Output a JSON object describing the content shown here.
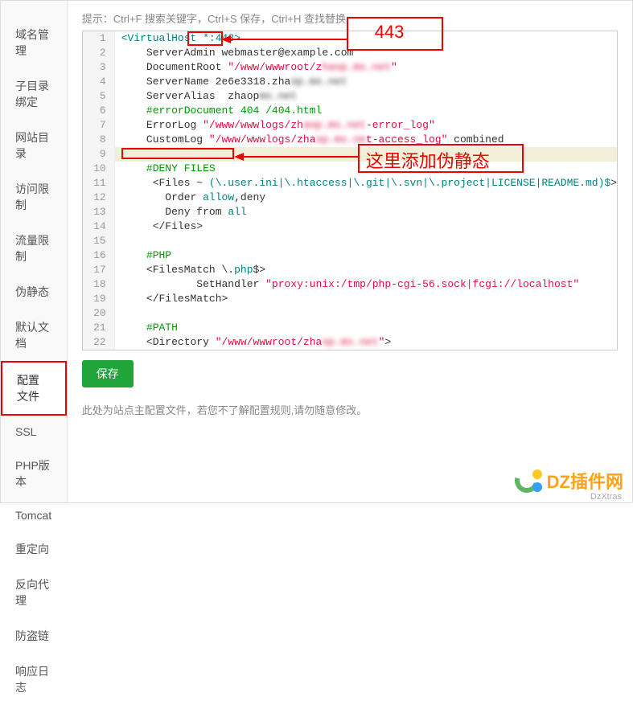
{
  "sidebar": {
    "items": [
      {
        "label": "域名管理",
        "name": "domain-manage"
      },
      {
        "label": "子目录绑定",
        "name": "subdir-bind"
      },
      {
        "label": "网站目录",
        "name": "site-dir"
      },
      {
        "label": "访问限制",
        "name": "access-limit"
      },
      {
        "label": "流量限制",
        "name": "traffic-limit"
      },
      {
        "label": "伪静态",
        "name": "rewrite"
      },
      {
        "label": "默认文档",
        "name": "default-doc"
      },
      {
        "label": "配置文件",
        "name": "config-file",
        "active": true
      },
      {
        "label": "SSL",
        "name": "ssl"
      },
      {
        "label": "PHP版本",
        "name": "php-version"
      },
      {
        "label": "Tomcat",
        "name": "tomcat"
      },
      {
        "label": "重定向",
        "name": "redirect"
      },
      {
        "label": "反向代理",
        "name": "reverse-proxy"
      },
      {
        "label": "防盗链",
        "name": "hotlink"
      },
      {
        "label": "响应日志",
        "name": "response-log"
      }
    ]
  },
  "hint": "提示：Ctrl+F 搜索关键字，Ctrl+S 保存，Ctrl+H 查找替换",
  "annotations": {
    "top_label": "443",
    "right_label": "这里添加伪静态"
  },
  "code_lines": [
    {
      "n": 1,
      "segs": [
        {
          "t": "<VirtualHost *:",
          "c": "tag"
        },
        {
          "t": "443",
          "c": "tag"
        },
        {
          "t": ">",
          "c": "tag"
        }
      ]
    },
    {
      "n": 2,
      "segs": [
        {
          "t": "    ServerAdmin webmaster@example.com",
          "c": "plain"
        }
      ]
    },
    {
      "n": 3,
      "segs": [
        {
          "t": "    DocumentRoot ",
          "c": "plain"
        },
        {
          "t": "\"/www/wwwroot/z",
          "c": "string"
        },
        {
          "t": "haop.ms.net",
          "c": "string",
          "blur": true
        },
        {
          "t": "\"",
          "c": "string"
        }
      ]
    },
    {
      "n": 4,
      "segs": [
        {
          "t": "    ServerName 2e6e3318.zha",
          "c": "plain"
        },
        {
          "t": "op.ms.net",
          "c": "plain",
          "blur": true
        }
      ]
    },
    {
      "n": 5,
      "segs": [
        {
          "t": "    ServerAlias  zhaop",
          "c": "plain"
        },
        {
          "t": "ms.net",
          "c": "plain",
          "blur": true
        }
      ]
    },
    {
      "n": 6,
      "segs": [
        {
          "t": "    #errorDocument 404 /404.html",
          "c": "comment"
        }
      ]
    },
    {
      "n": 7,
      "segs": [
        {
          "t": "    ErrorLog ",
          "c": "plain"
        },
        {
          "t": "\"/www/wwwlogs/zh",
          "c": "string"
        },
        {
          "t": "aop.ms.net",
          "c": "string",
          "blur": true
        },
        {
          "t": "-error_log\"",
          "c": "string"
        }
      ]
    },
    {
      "n": 8,
      "segs": [
        {
          "t": "    CustomLog ",
          "c": "plain"
        },
        {
          "t": "\"/www/wwwlogs/zha",
          "c": "string"
        },
        {
          "t": "op.ms.ne",
          "c": "string",
          "blur": true
        },
        {
          "t": "t-access_log\"",
          "c": "string"
        },
        {
          "t": " combined",
          "c": "plain"
        }
      ]
    },
    {
      "n": 9,
      "hl": true,
      "segs": [
        {
          "t": "",
          "c": "plain"
        }
      ],
      "cursor": true
    },
    {
      "n": 10,
      "segs": [
        {
          "t": "    #DENY FILES",
          "c": "comment"
        }
      ]
    },
    {
      "n": 11,
      "segs": [
        {
          "t": "     <Files ~ ",
          "c": "plain"
        },
        {
          "t": "(\\.user.ini|\\.htaccess|\\.git|\\.svn|\\.project|LICENSE|README.md)$",
          "c": "tag"
        },
        {
          "t": ">",
          "c": "plain"
        }
      ]
    },
    {
      "n": 12,
      "segs": [
        {
          "t": "       Order ",
          "c": "plain"
        },
        {
          "t": "allow",
          "c": "attr"
        },
        {
          "t": ",deny",
          "c": "plain"
        }
      ]
    },
    {
      "n": 13,
      "segs": [
        {
          "t": "       Deny from ",
          "c": "plain"
        },
        {
          "t": "all",
          "c": "attr"
        }
      ]
    },
    {
      "n": 14,
      "segs": [
        {
          "t": "     </Files>",
          "c": "plain"
        }
      ]
    },
    {
      "n": 15,
      "segs": [
        {
          "t": "",
          "c": "plain"
        }
      ]
    },
    {
      "n": 16,
      "segs": [
        {
          "t": "    #PHP",
          "c": "comment"
        }
      ]
    },
    {
      "n": 17,
      "segs": [
        {
          "t": "    <FilesMatch \\.",
          "c": "plain"
        },
        {
          "t": "php",
          "c": "attr"
        },
        {
          "t": "$>",
          "c": "plain"
        }
      ]
    },
    {
      "n": 18,
      "segs": [
        {
          "t": "            SetHandler ",
          "c": "plain"
        },
        {
          "t": "\"proxy:unix:/tmp/php-cgi-56.sock|fcgi://localhost\"",
          "c": "string"
        }
      ]
    },
    {
      "n": 19,
      "segs": [
        {
          "t": "    </FilesMatch>",
          "c": "plain"
        }
      ]
    },
    {
      "n": 20,
      "segs": [
        {
          "t": "",
          "c": "plain"
        }
      ]
    },
    {
      "n": 21,
      "segs": [
        {
          "t": "    #PATH",
          "c": "comment"
        }
      ]
    },
    {
      "n": 22,
      "segs": [
        {
          "t": "    <Directory ",
          "c": "plain"
        },
        {
          "t": "\"/www/wwwroot/zha",
          "c": "string"
        },
        {
          "t": "op.ms.net",
          "c": "string",
          "blur": true
        },
        {
          "t": "\"",
          "c": "string"
        },
        {
          "t": ">",
          "c": "plain"
        }
      ]
    }
  ],
  "save_label": "保存",
  "footnote": "此处为站点主配置文件，若您不了解配置规则,请勿随意修改。",
  "watermark": {
    "text": "DZ插件网",
    "sub": "DzXtras"
  }
}
